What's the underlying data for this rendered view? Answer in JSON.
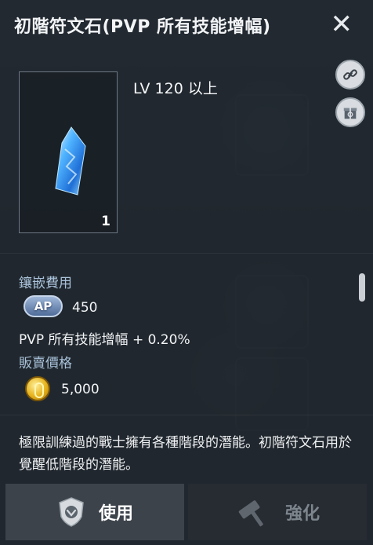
{
  "header": {
    "title": "初階符文石(PVP 所有技能增幅)"
  },
  "item": {
    "level_requirement": "LV 120 以上",
    "quantity": "1"
  },
  "side_buttons": {
    "link_icon": "link-icon",
    "gift_icon": "gift-box-icon"
  },
  "inlay": {
    "label": "鑲嵌費用",
    "currency_badge": "AP",
    "cost": "450"
  },
  "effect": {
    "text": "PVP 所有技能增幅  + 0.20%"
  },
  "sell": {
    "label": "販賣價格",
    "currency_icon": "gold-coin-icon",
    "price": "5,000"
  },
  "description": "極限訓練過的戰士擁有各種階段的潛能。初階符文石用於覺醒低階段的潛能。",
  "actions": {
    "use_label": "使用",
    "upgrade_label": "強化"
  },
  "colors": {
    "label": "#a9c2d9",
    "ap_badge": "#6f8dbd",
    "coin": "#e6b21c",
    "use_button": "#3c434b"
  }
}
